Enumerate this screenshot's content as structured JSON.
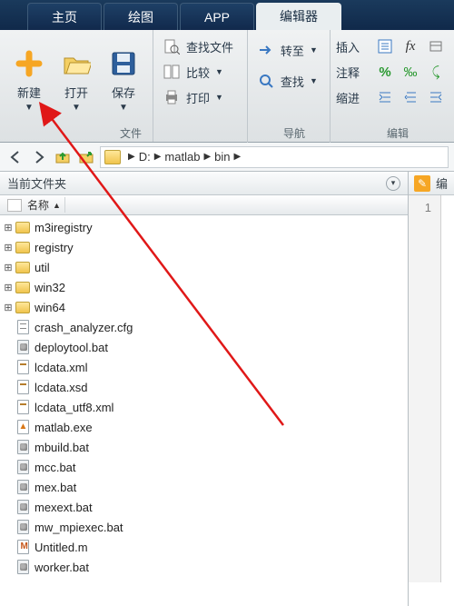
{
  "tabs": [
    "主页",
    "绘图",
    "APP",
    "编辑器"
  ],
  "activeTab": 3,
  "toolstrip": {
    "file": {
      "new": "新建",
      "open": "打开",
      "save": "保存",
      "findfiles": "查找文件",
      "compare": "比较",
      "print": "打印",
      "label": "文件"
    },
    "nav": {
      "goto": "转至",
      "find": "查找",
      "label": "导航"
    },
    "edit": {
      "insert": "插入",
      "comment": "注释",
      "indent": "缩进",
      "label": "编辑"
    }
  },
  "breadcrumb": [
    "D:",
    "matlab",
    "bin"
  ],
  "panel": {
    "title": "当前文件夹",
    "namecol": "名称"
  },
  "files": [
    {
      "name": "m3iregistry",
      "type": "folder",
      "expandable": true
    },
    {
      "name": "registry",
      "type": "folder",
      "expandable": true
    },
    {
      "name": "util",
      "type": "folder",
      "expandable": true
    },
    {
      "name": "win32",
      "type": "folder",
      "expandable": true
    },
    {
      "name": "win64",
      "type": "folder",
      "expandable": true
    },
    {
      "name": "crash_analyzer.cfg",
      "type": "cfg"
    },
    {
      "name": "deploytool.bat",
      "type": "bat"
    },
    {
      "name": "lcdata.xml",
      "type": "xml"
    },
    {
      "name": "lcdata.xsd",
      "type": "xml"
    },
    {
      "name": "lcdata_utf8.xml",
      "type": "xml"
    },
    {
      "name": "matlab.exe",
      "type": "exe"
    },
    {
      "name": "mbuild.bat",
      "type": "bat"
    },
    {
      "name": "mcc.bat",
      "type": "bat"
    },
    {
      "name": "mex.bat",
      "type": "bat"
    },
    {
      "name": "mexext.bat",
      "type": "bat"
    },
    {
      "name": "mw_mpiexec.bat",
      "type": "bat"
    },
    {
      "name": "Untitled.m",
      "type": "m"
    },
    {
      "name": "worker.bat",
      "type": "bat"
    }
  ],
  "editor": {
    "label": "编",
    "lineno": "1"
  },
  "colors": {
    "accent": "#f6a624",
    "tabbg": "#13304f"
  }
}
